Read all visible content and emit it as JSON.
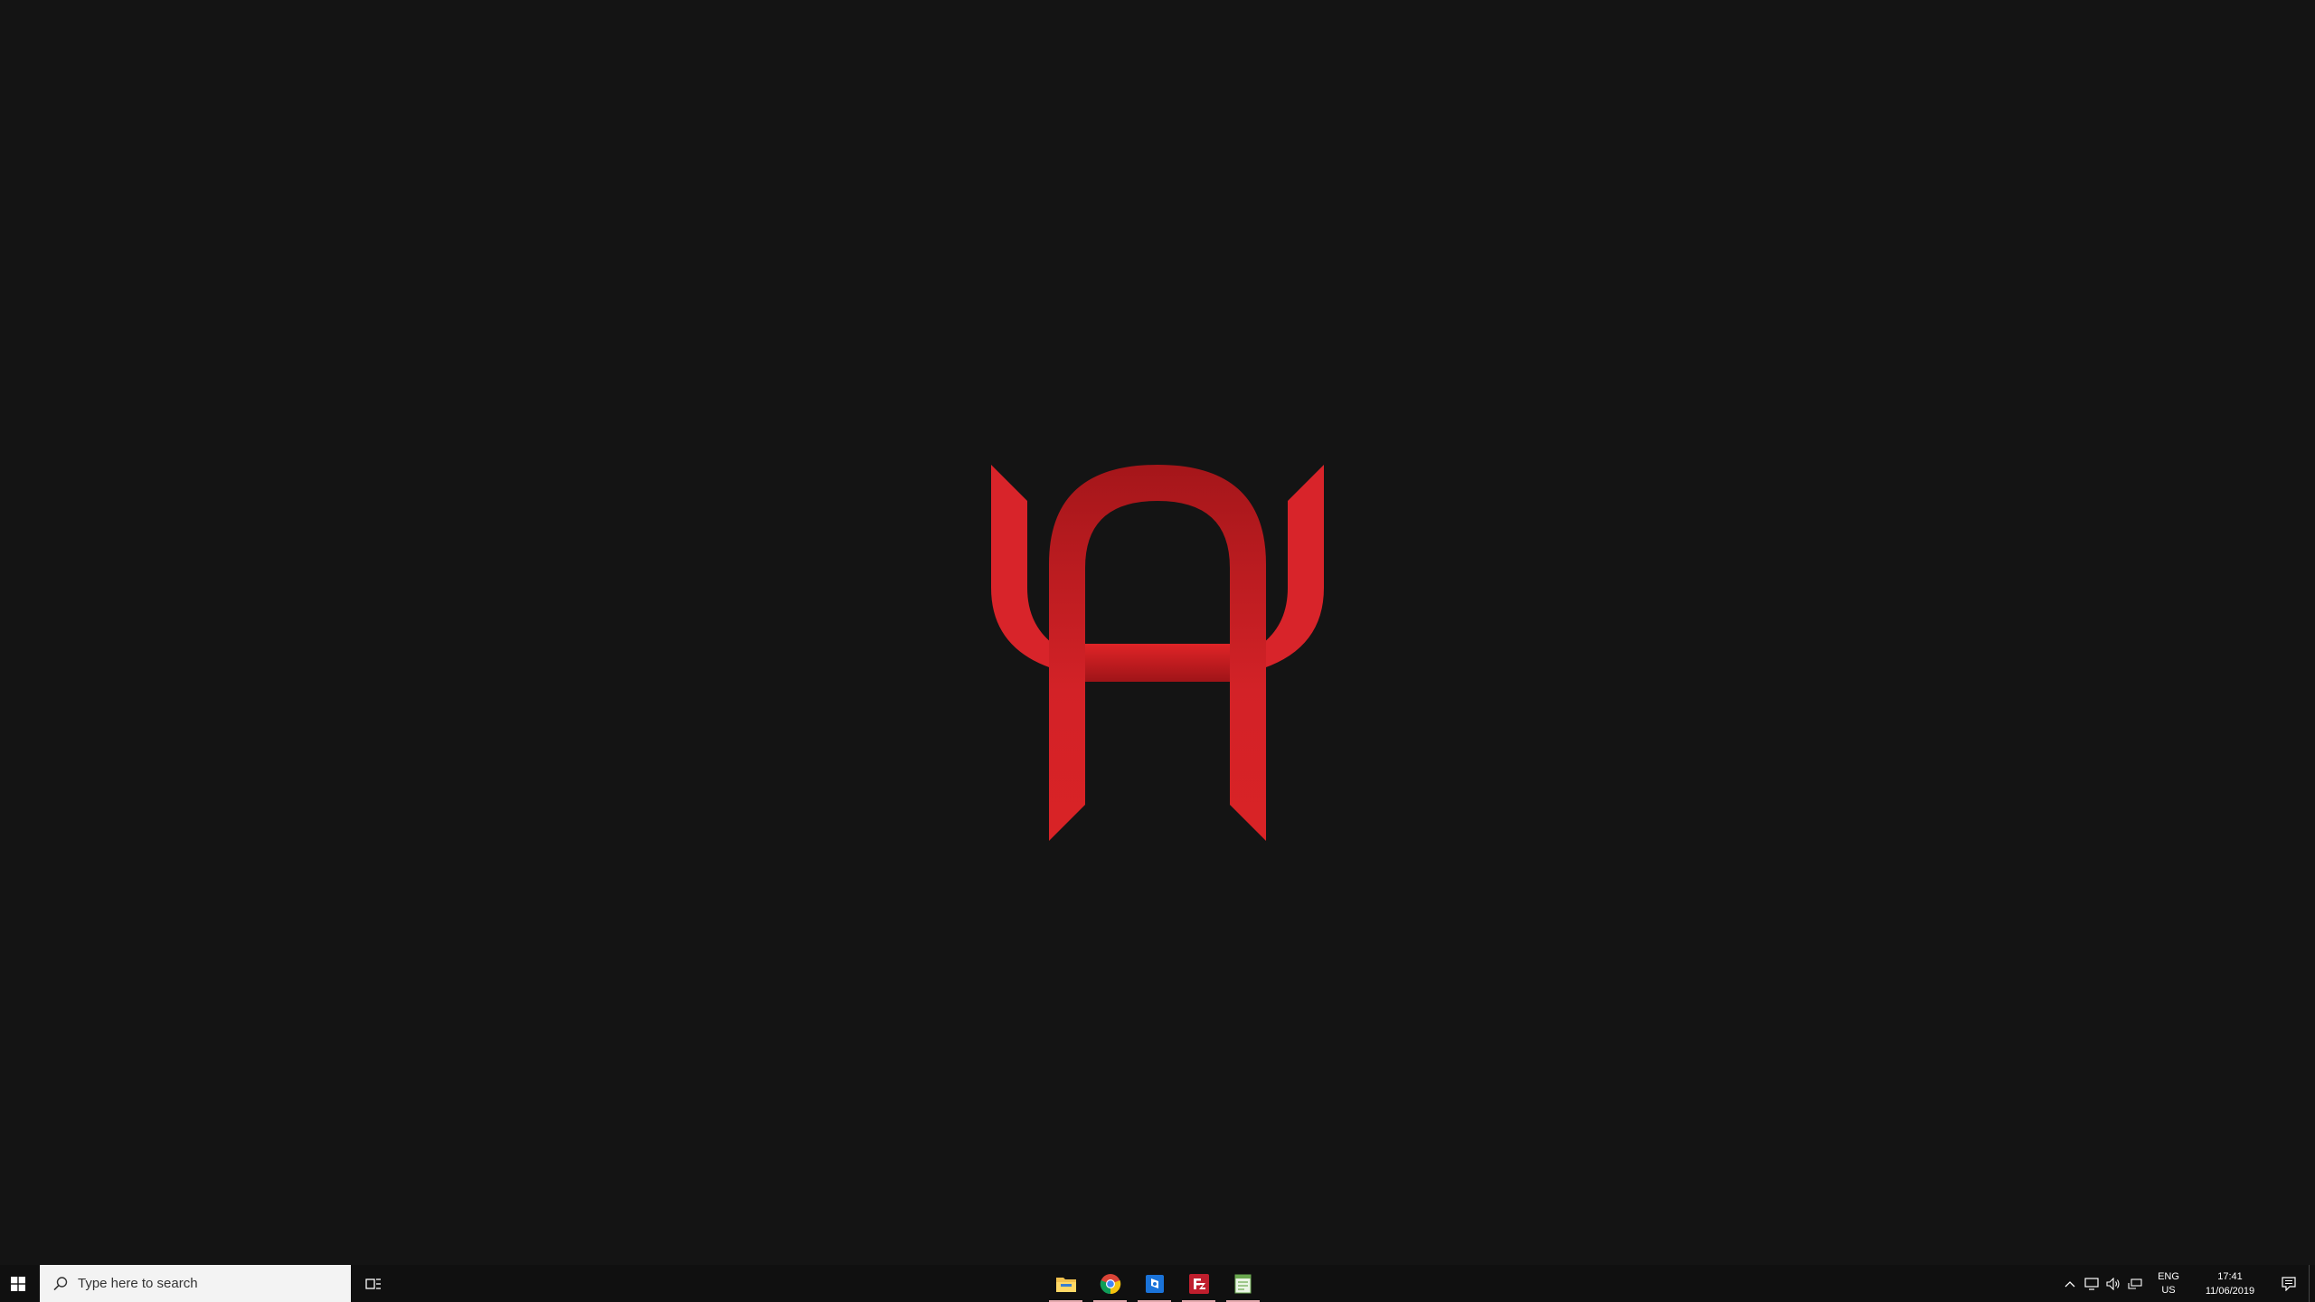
{
  "search": {
    "placeholder": "Type here to search"
  },
  "taskbar": {
    "pinned": [
      {
        "name": "file-explorer",
        "icon": "folder-icon"
      },
      {
        "name": "chrome",
        "icon": "chrome-icon"
      },
      {
        "name": "blue-app",
        "icon": "blue-app-icon"
      },
      {
        "name": "filezilla",
        "icon": "filezilla-icon"
      },
      {
        "name": "notepad",
        "icon": "notepad-icon"
      }
    ]
  },
  "tray": {
    "lang_top": "ENG",
    "lang_bottom": "US",
    "time": "17:41",
    "date": "11/06/2019"
  },
  "colors": {
    "wallpaper_bg": "#141414",
    "logo_red": "#d92326",
    "logo_dark_red": "#a8161a"
  }
}
